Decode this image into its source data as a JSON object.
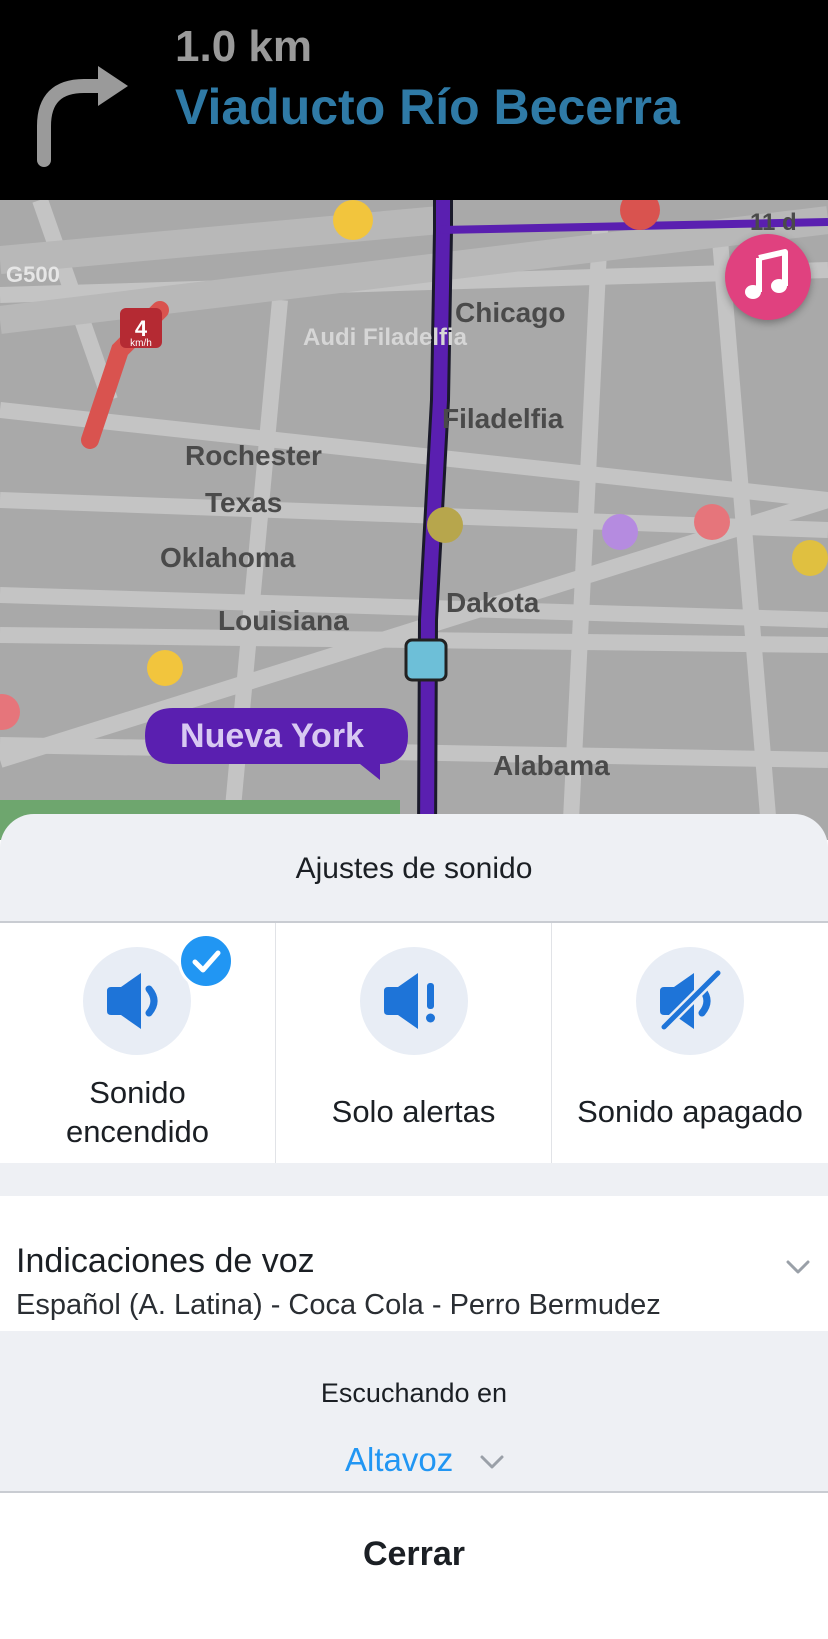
{
  "navigation": {
    "distance": "1.0 km",
    "street": "Viaducto Río Becerra",
    "turn_icon": "turn-right-arrow-icon"
  },
  "map": {
    "streets": [
      "G500",
      "Audi Filadelfia",
      "Chicago",
      "Filadelfia",
      "Rochester",
      "Texas",
      "Oklahoma",
      "Louisiana",
      "Dakota",
      "Alabama",
      "11 d"
    ],
    "speed_sign": {
      "value": "4",
      "unit": "km/h"
    },
    "location_label": "Nueva York",
    "route_color": "#5a1fb0",
    "music_button_icon": "music-note-icon"
  },
  "sound_settings": {
    "title": "Ajustes de sonido",
    "options": [
      {
        "label": "Sonido encendido",
        "icon": "speaker-on-icon",
        "selected": true
      },
      {
        "label": "Solo alertas",
        "icon": "speaker-alert-icon",
        "selected": false
      },
      {
        "label": "Sonido apagado",
        "icon": "speaker-muted-icon",
        "selected": false
      }
    ],
    "voice": {
      "title": "Indicaciones de voz",
      "value": "Español (A. Latina) - Coca Cola - Perro Bermudez"
    },
    "listening": {
      "label": "Escuchando en",
      "value": "Altavoz"
    },
    "close_label": "Cerrar",
    "accent_color": "#2196f3"
  }
}
